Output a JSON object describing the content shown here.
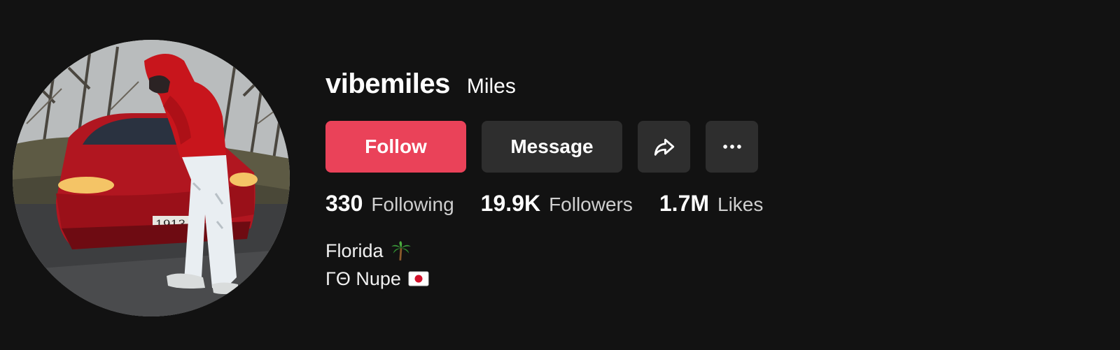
{
  "profile": {
    "username": "vibemiles",
    "nickname": "Miles",
    "avatar_alt": "profile photo"
  },
  "actions": {
    "follow_label": "Follow",
    "message_label": "Message",
    "share_icon": "share-arrow-icon",
    "more_icon": "more-dots-icon"
  },
  "stats": [
    {
      "value": "330",
      "label": "Following"
    },
    {
      "value": "19.9K",
      "label": "Followers"
    },
    {
      "value": "1.7M",
      "label": "Likes"
    }
  ],
  "bio": {
    "line1": "Florida",
    "line1_emoji": "palm-tree-icon",
    "line2": "ΓΘ Nupe",
    "line2_emoji": "japan-flag-icon"
  },
  "colors": {
    "background": "#121212",
    "follow": "#ea4259",
    "secondary_button": "#2e2e2e"
  }
}
